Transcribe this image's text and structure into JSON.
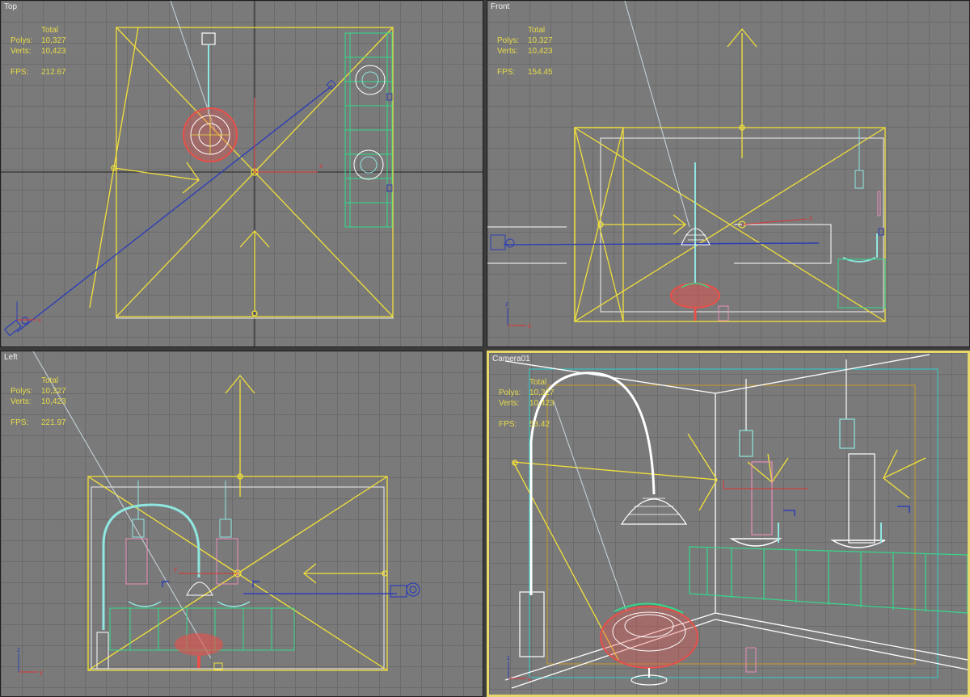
{
  "viewports": {
    "top": {
      "label": "Top",
      "stats": {
        "header": "Total",
        "polys_label": "Polys:",
        "polys": "10,327",
        "verts_label": "Verts:",
        "verts": "10,423",
        "fps_label": "FPS:",
        "fps": "212.67"
      }
    },
    "front": {
      "label": "Front",
      "stats": {
        "header": "Total",
        "polys_label": "Polys:",
        "polys": "10,327",
        "verts_label": "Verts:",
        "verts": "10,423",
        "fps_label": "FPS:",
        "fps": "154.45"
      }
    },
    "left": {
      "label": "Left",
      "stats": {
        "header": "Total",
        "polys_label": "Polys:",
        "polys": "10,327",
        "verts_label": "Verts:",
        "verts": "10,423",
        "fps_label": "FPS:",
        "fps": "221.97"
      }
    },
    "camera": {
      "label": "Camera01",
      "stats": {
        "header": "Total",
        "polys_label": "Polys:",
        "polys": "10,327",
        "verts_label": "Verts:",
        "verts": "10,423",
        "fps_label": "FPS:",
        "fps": "53.42"
      }
    }
  },
  "axis_labels": {
    "x": "x",
    "y": "y",
    "z": "z"
  },
  "colors": {
    "light_yellow": "#f2e03a",
    "camera_blue": "#2d3fb5",
    "cabinet_green": "#33d98a",
    "chair_red": "#e8504a",
    "white": "#ffffff",
    "lamp_cyan": "#8fe6e0",
    "active_border": "#e6d86a"
  }
}
